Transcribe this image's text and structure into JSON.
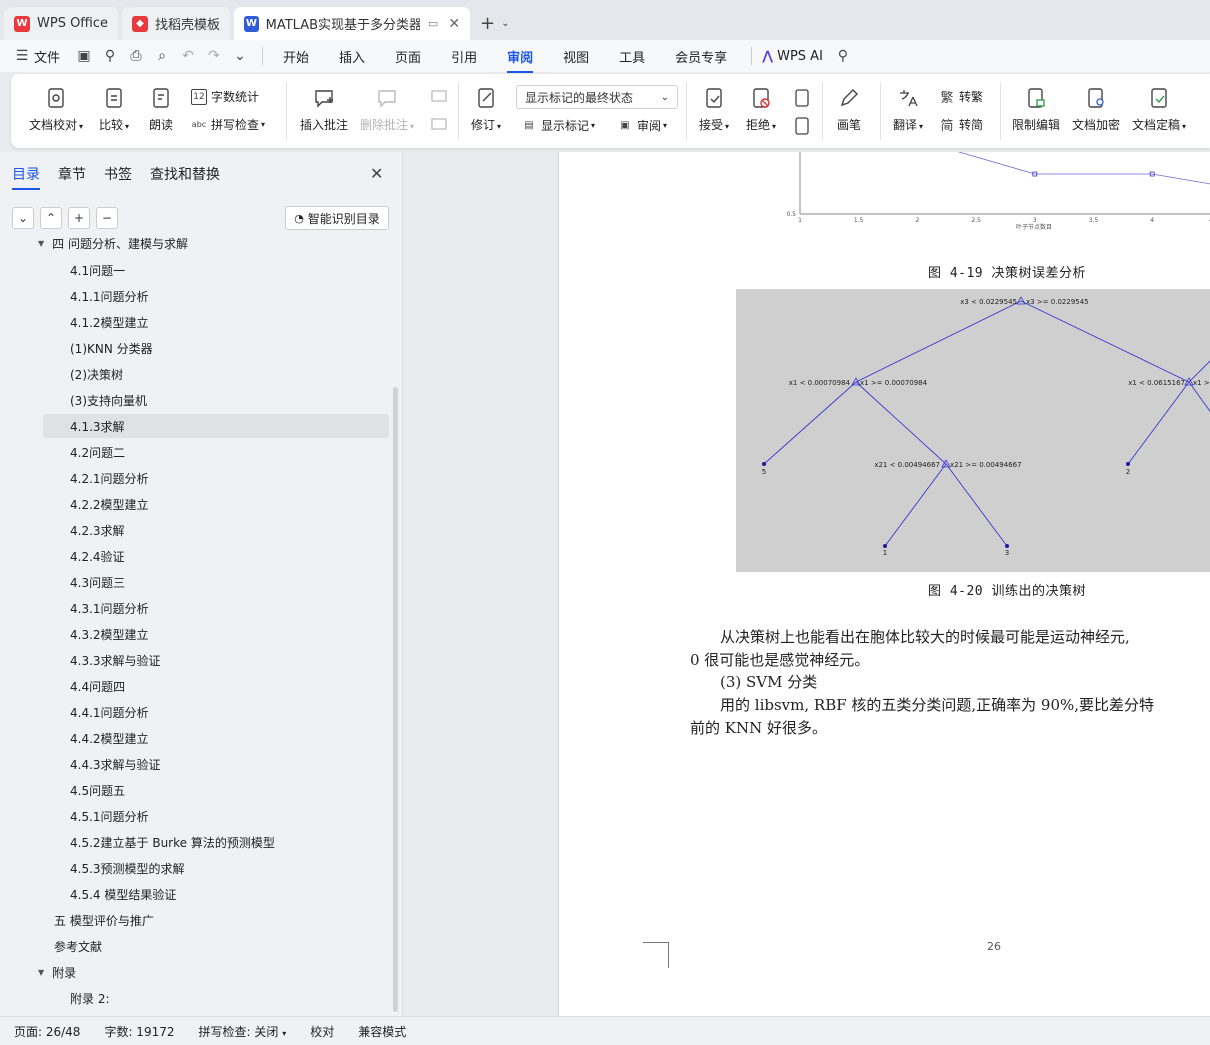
{
  "tabs": [
    {
      "label": "WPS Office",
      "icon": "wps-logo-icon",
      "color": "#e8393c"
    },
    {
      "label": "找稻壳模板",
      "icon": "docer-icon",
      "color": "#e8393c"
    },
    {
      "label": "MATLAB实现基于多分类器集",
      "icon": "word-doc-icon",
      "color": "#2f5bd8"
    }
  ],
  "menu": {
    "file": "文件",
    "items": [
      "开始",
      "插入",
      "页面",
      "引用",
      "审阅",
      "视图",
      "工具",
      "会员专享"
    ],
    "active_index": 4,
    "wps_ai": "WPS AI"
  },
  "ribbon": {
    "doc_proof": "文档校对",
    "compare": "比较",
    "read_aloud": "朗读",
    "word_count": "字数统计",
    "spell_check": "拼写检查",
    "insert_comment": "插入批注",
    "delete_comment": "删除批注",
    "revise": "修订",
    "markup_state": "显示标记的最终状态",
    "show_markup": "显示标记",
    "review": "审阅",
    "accept": "接受",
    "reject": "拒绝",
    "pen": "画笔",
    "translate": "翻译",
    "to_traditional": "转繁",
    "to_simplified": "转简",
    "trad_glyph": "繁",
    "simp_glyph": "简",
    "restrict_edit": "限制编辑",
    "encrypt_doc": "文档加密",
    "finalize_doc": "文档定稿",
    "wordcount_glyph": "12"
  },
  "panel": {
    "tabs": [
      "目录",
      "章节",
      "书签",
      "查找和替换"
    ],
    "smart_toc": "智能识别目录",
    "toc": [
      {
        "label": "四 问题分析、建模与求解",
        "level": 0,
        "expanded": true,
        "partial": true
      },
      {
        "label": "4.1问题一",
        "level": 1
      },
      {
        "label": "4.1.1问题分析",
        "level": 1
      },
      {
        "label": "4.1.2模型建立",
        "level": 1
      },
      {
        "label": "(1)KNN 分类器",
        "level": 1
      },
      {
        "label": "(2)决策树",
        "level": 1
      },
      {
        "label": "(3)支持向量机",
        "level": 1
      },
      {
        "label": "4.1.3求解",
        "level": 1,
        "selected": true
      },
      {
        "label": "4.2问题二",
        "level": 1
      },
      {
        "label": "4.2.1问题分析",
        "level": 1
      },
      {
        "label": "4.2.2模型建立",
        "level": 1
      },
      {
        "label": "4.2.3求解",
        "level": 1
      },
      {
        "label": "4.2.4验证",
        "level": 1
      },
      {
        "label": "4.3问题三",
        "level": 1
      },
      {
        "label": "4.3.1问题分析",
        "level": 1
      },
      {
        "label": "4.3.2模型建立",
        "level": 1
      },
      {
        "label": "4.3.3求解与验证",
        "level": 1
      },
      {
        "label": "4.4问题四",
        "level": 1
      },
      {
        "label": "4.4.1问题分析",
        "level": 1
      },
      {
        "label": "4.4.2模型建立",
        "level": 1
      },
      {
        "label": "4.4.3求解与验证",
        "level": 1
      },
      {
        "label": "4.5问题五",
        "level": 1
      },
      {
        "label": "4.5.1问题分析",
        "level": 1
      },
      {
        "label": "4.5.2建立基于 Burke 算法的预测模型",
        "level": 1
      },
      {
        "label": "4.5.3预测模型的求解",
        "level": 1
      },
      {
        "label": "4.5.4 模型结果验证",
        "level": 1
      },
      {
        "label": "五 模型评价与推广",
        "level": 0
      },
      {
        "label": "参考文献",
        "level": 0
      },
      {
        "label": "附录",
        "level": 0,
        "expanded": true
      },
      {
        "label": "附录 2:",
        "level": 1
      }
    ]
  },
  "document": {
    "fig19_caption": "图 4-19 决策树误差分析",
    "fig20_caption": "图 4-20 训练出的决策树",
    "para1_line1": "从决策树上也能看出在胞体比较大的时候最可能是运动神经元,",
    "para1_line2": "0 很可能也是感觉神经元。",
    "para2": "(3) SVM 分类",
    "para3_line1": "用的 libsvm, RBF 核的五类分类问题,正确率为 90%,要比差分特",
    "para3_line2": "前的 KNN 好很多。",
    "page_number": "26",
    "chart_data": {
      "type": "line",
      "xlabel": "叶子节点数目",
      "x_ticks": [
        "1",
        "1.5",
        "2",
        "2.5",
        "3",
        "3.5",
        "4",
        "4"
      ],
      "y_ticks": [
        "0.5"
      ],
      "x": [
        3,
        4,
        4.5
      ],
      "y": [
        0.58,
        0.58,
        0.56
      ],
      "note": "partially visible; upper portion cropped"
    },
    "tree": {
      "root": "x3 < 0.0229545",
      "root_right": "x3 >= 0.0229545",
      "l_split": "x1 < 0.00070984",
      "l_split_right": "x1 >= 0.00070984",
      "r_split": "x1 < 0.0615167",
      "r_split_right": "x1 >=",
      "ll_split": "x21 < 0.00494667",
      "ll_split_right": "x21 >= 0.00494667",
      "leaf_a": "5",
      "leaf_b": "1",
      "leaf_c": "3",
      "leaf_d": "2",
      "color": "#3a3acf",
      "bg": "#cfcfcf"
    }
  },
  "status": {
    "page": "页面: 26/48",
    "words": "字数: 19172",
    "spell": "拼写检查: 关闭",
    "proof": "校对",
    "compat": "兼容模式"
  }
}
